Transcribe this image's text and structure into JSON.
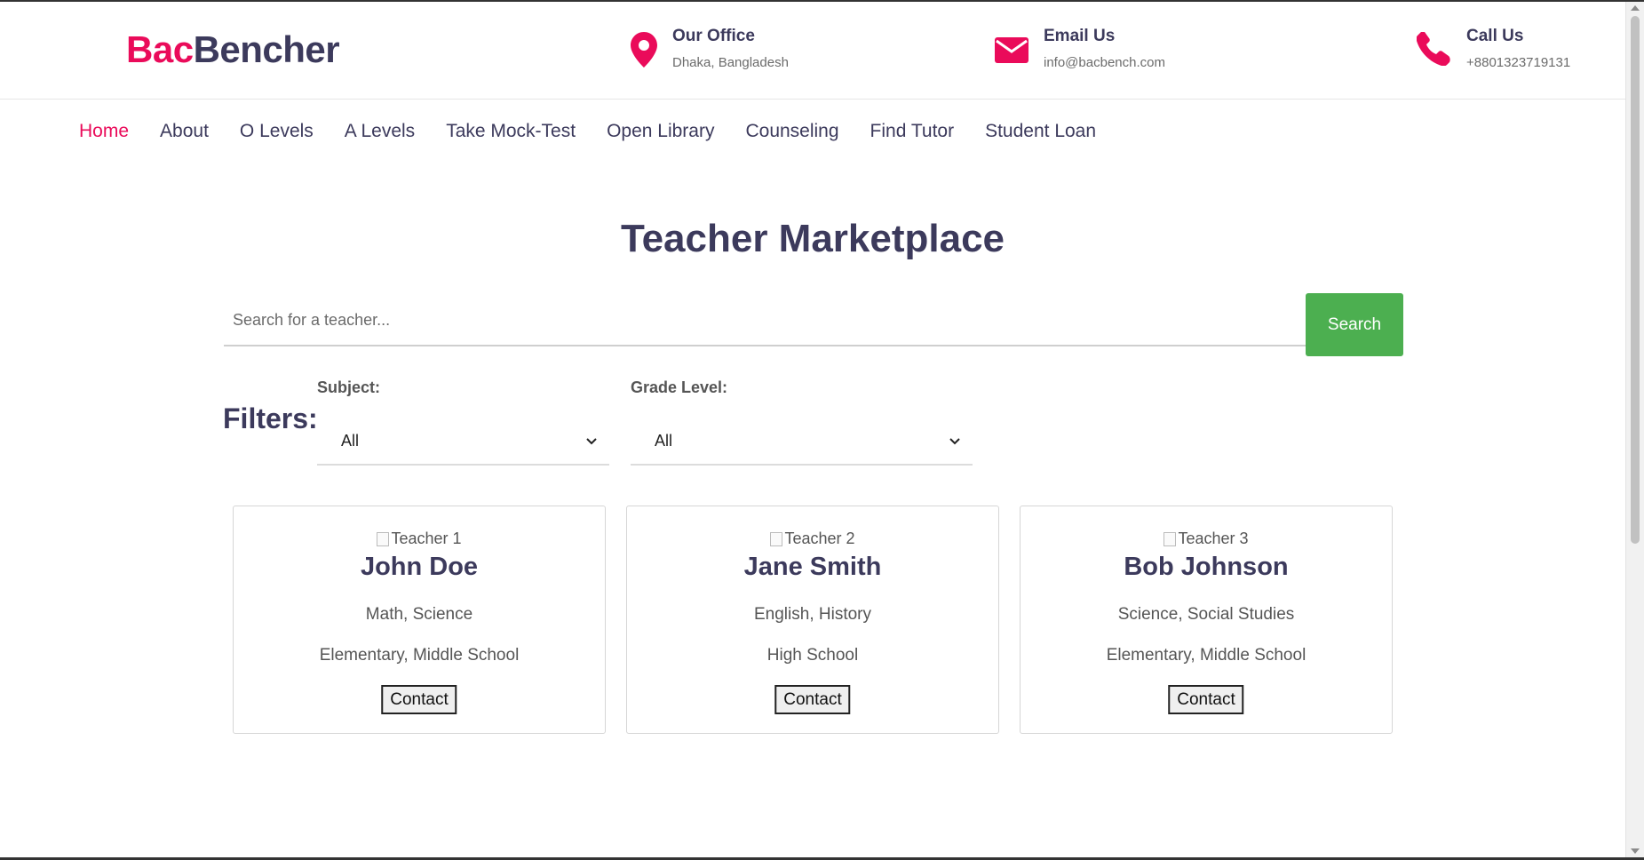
{
  "brand": {
    "part1": "Bac",
    "part2": "Bencher",
    "accent": "#ea0b5a",
    "dark": "#3c3a5c"
  },
  "header": {
    "office": {
      "title": "Our Office",
      "value": "Dhaka, Bangladesh",
      "icon": "location-pin-icon"
    },
    "email": {
      "title": "Email Us",
      "value": "info@bacbench.com",
      "icon": "envelope-icon"
    },
    "call": {
      "title": "Call Us",
      "value": "+8801323719131",
      "icon": "phone-icon"
    }
  },
  "nav": {
    "items": [
      {
        "label": "Home",
        "active": true
      },
      {
        "label": "About"
      },
      {
        "label": "O Levels"
      },
      {
        "label": "A Levels"
      },
      {
        "label": "Take Mock-Test"
      },
      {
        "label": "Open Library"
      },
      {
        "label": "Counseling"
      },
      {
        "label": "Find Tutor"
      },
      {
        "label": "Student Loan"
      }
    ]
  },
  "page": {
    "title": "Teacher Marketplace"
  },
  "search": {
    "placeholder": "Search for a teacher...",
    "value": "",
    "button": "Search",
    "button_color": "#4caf50"
  },
  "filters": {
    "label": "Filters:",
    "subject": {
      "label": "Subject:",
      "value": "All"
    },
    "grade": {
      "label": "Grade Level:",
      "value": "All"
    }
  },
  "teachers": [
    {
      "img_alt": "Teacher 1",
      "name": "John Doe",
      "subjects": "Math, Science",
      "grades": "Elementary, Middle School",
      "button": "Contact"
    },
    {
      "img_alt": "Teacher 2",
      "name": "Jane Smith",
      "subjects": "English, History",
      "grades": "High School",
      "button": "Contact"
    },
    {
      "img_alt": "Teacher 3",
      "name": "Bob Johnson",
      "subjects": "Science, Social Studies",
      "grades": "Elementary, Middle School",
      "button": "Contact"
    }
  ]
}
